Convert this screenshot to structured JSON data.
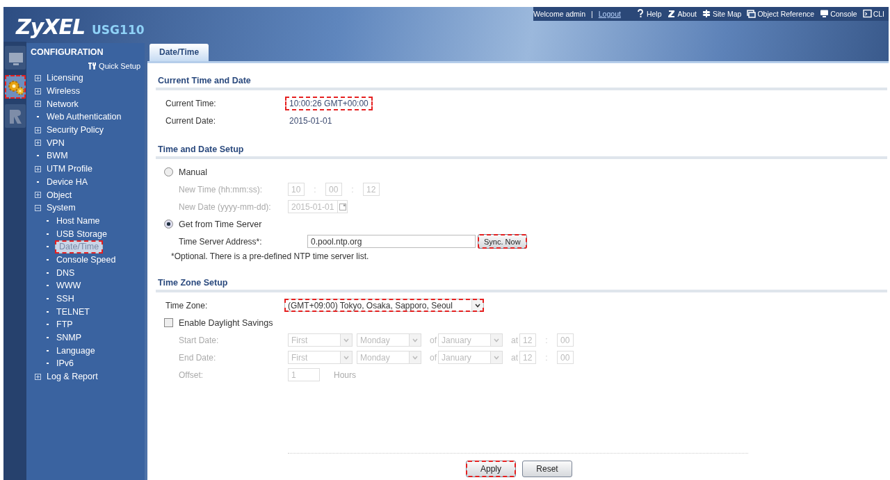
{
  "header": {
    "logo": "ZyXEL",
    "model": "USG110",
    "welcome": "Welcome admin",
    "separator": "|",
    "logout": "Logout",
    "links": [
      {
        "label": "Help"
      },
      {
        "label": "About"
      },
      {
        "label": "Site Map"
      },
      {
        "label": "Object Reference"
      },
      {
        "label": "Console"
      },
      {
        "label": "CLI"
      }
    ]
  },
  "rail": [
    {
      "selected": false,
      "highlighted": false
    },
    {
      "selected": true,
      "highlighted": true
    },
    {
      "selected": false,
      "highlighted": false
    }
  ],
  "sidebar": {
    "title": "CONFIGURATION",
    "quick_setup": "Quick Setup",
    "items": [
      {
        "label": "Licensing",
        "expanded": false,
        "selected": false,
        "highlighted": false
      },
      {
        "label": "Wireless",
        "expanded": false,
        "selected": false,
        "highlighted": false
      },
      {
        "label": "Network",
        "expanded": false,
        "selected": false,
        "highlighted": false
      },
      {
        "label": "Web Authentication",
        "kind": "leaf",
        "selected": false,
        "highlighted": false
      },
      {
        "label": "Security Policy",
        "expanded": false,
        "selected": false,
        "highlighted": false
      },
      {
        "label": "VPN",
        "expanded": false,
        "selected": false,
        "highlighted": false
      },
      {
        "label": "BWM",
        "kind": "leaf",
        "selected": false,
        "highlighted": false
      },
      {
        "label": "UTM Profile",
        "expanded": false,
        "selected": false,
        "highlighted": false
      },
      {
        "label": "Device HA",
        "kind": "leaf",
        "selected": false,
        "highlighted": false
      },
      {
        "label": "Object",
        "expanded": false,
        "selected": false,
        "highlighted": false
      },
      {
        "label": "System",
        "expanded": true,
        "selected": false,
        "highlighted": false,
        "children": [
          {
            "label": "Host Name",
            "kind": "leaf",
            "selected": false,
            "highlighted": false
          },
          {
            "label": "USB Storage",
            "kind": "leaf",
            "selected": false,
            "highlighted": false
          },
          {
            "label": "Date/Time",
            "kind": "leaf",
            "selected": true,
            "highlighted": true
          },
          {
            "label": "Console Speed",
            "kind": "leaf",
            "selected": false,
            "highlighted": false
          },
          {
            "label": "DNS",
            "kind": "leaf",
            "selected": false,
            "highlighted": false
          },
          {
            "label": "WWW",
            "kind": "leaf",
            "selected": false,
            "highlighted": false
          },
          {
            "label": "SSH",
            "kind": "leaf",
            "selected": false,
            "highlighted": false
          },
          {
            "label": "TELNET",
            "kind": "leaf",
            "selected": false,
            "highlighted": false
          },
          {
            "label": "FTP",
            "kind": "leaf",
            "selected": false,
            "highlighted": false
          },
          {
            "label": "SNMP",
            "kind": "leaf",
            "selected": false,
            "highlighted": false
          },
          {
            "label": "Language",
            "kind": "leaf",
            "selected": false,
            "highlighted": false
          },
          {
            "label": "IPv6",
            "kind": "leaf",
            "selected": false,
            "highlighted": false
          }
        ]
      },
      {
        "label": "Log & Report",
        "expanded": false,
        "selected": false,
        "highlighted": false
      }
    ]
  },
  "tabs": [
    {
      "label": "Date/Time",
      "selected": true
    }
  ],
  "sections": [
    {
      "title": "Current Time and Date",
      "rows": [
        {
          "kind": "info",
          "label": "Current Time:",
          "value": "10:00:26 GMT+00:00",
          "highlighted": true
        },
        {
          "kind": "info",
          "label": "Current Date:",
          "value": "2015-01-01",
          "highlighted": false
        }
      ]
    },
    {
      "title": "Time and Date Setup",
      "rows": [
        {
          "kind": "radio",
          "label": "Manual",
          "selected": false
        },
        {
          "kind": "fields",
          "label": "New Time (hh:mm:ss):",
          "disabled": true,
          "parts": [
            {
              "kind": "input",
              "value": "10"
            },
            {
              "kind": "sep",
              "value": ":"
            },
            {
              "kind": "input",
              "value": "00"
            },
            {
              "kind": "sep",
              "value": ":"
            },
            {
              "kind": "input",
              "value": "12"
            }
          ]
        },
        {
          "kind": "fields",
          "label": "New Date (yyyy-mm-dd):",
          "disabled": true,
          "parts": [
            {
              "kind": "date",
              "value": "2015-01-01"
            }
          ]
        },
        {
          "kind": "radio",
          "label": "Get from Time Server",
          "selected": true
        },
        {
          "kind": "server",
          "label": "Time Server Address*:",
          "disabled": false,
          "parts": [
            {
              "kind": "wide",
              "value": "0.pool.ntp.org"
            },
            {
              "kind": "button",
              "value": "Sync. Now",
              "highlighted": true
            }
          ]
        },
        {
          "kind": "note",
          "label": "*Optional. There is a pre-defined NTP time server list."
        }
      ]
    },
    {
      "title": "Time Zone Setup",
      "rows": [
        {
          "kind": "zone",
          "label": "Time Zone:",
          "disabled": false,
          "parts": [
            {
              "kind": "bigselect",
              "value": "(GMT+09:00) Tokyo, Osaka, Sapporo, Seoul",
              "highlighted": true
            }
          ]
        },
        {
          "kind": "checkbox",
          "label": "Enable Daylight Savings",
          "checked": false
        },
        {
          "kind": "fields",
          "label": "Start Date:",
          "disabled": true,
          "parts": [
            {
              "kind": "select",
              "value": "First"
            },
            {
              "kind": "select",
              "value": "Monday"
            },
            {
              "kind": "word",
              "value": "of"
            },
            {
              "kind": "select",
              "value": "January"
            },
            {
              "kind": "word",
              "value": "at"
            },
            {
              "kind": "input",
              "value": "12"
            },
            {
              "kind": "sep",
              "value": ":"
            },
            {
              "kind": "input",
              "value": "00"
            }
          ]
        },
        {
          "kind": "fields",
          "label": "End Date:",
          "disabled": true,
          "parts": [
            {
              "kind": "select",
              "value": "First"
            },
            {
              "kind": "select",
              "value": "Monday"
            },
            {
              "kind": "word",
              "value": "of"
            },
            {
              "kind": "select",
              "value": "January"
            },
            {
              "kind": "word",
              "value": "at"
            },
            {
              "kind": "input",
              "value": "12"
            },
            {
              "kind": "sep",
              "value": ":"
            },
            {
              "kind": "input",
              "value": "00"
            }
          ]
        },
        {
          "kind": "fields",
          "label": "Offset:",
          "disabled": true,
          "parts": [
            {
              "kind": "offset",
              "value": "1"
            },
            {
              "kind": "unit",
              "value": "Hours"
            }
          ]
        }
      ]
    }
  ],
  "buttons": [
    {
      "label": "Apply",
      "highlighted": true
    },
    {
      "label": "Reset",
      "highlighted": false
    }
  ]
}
